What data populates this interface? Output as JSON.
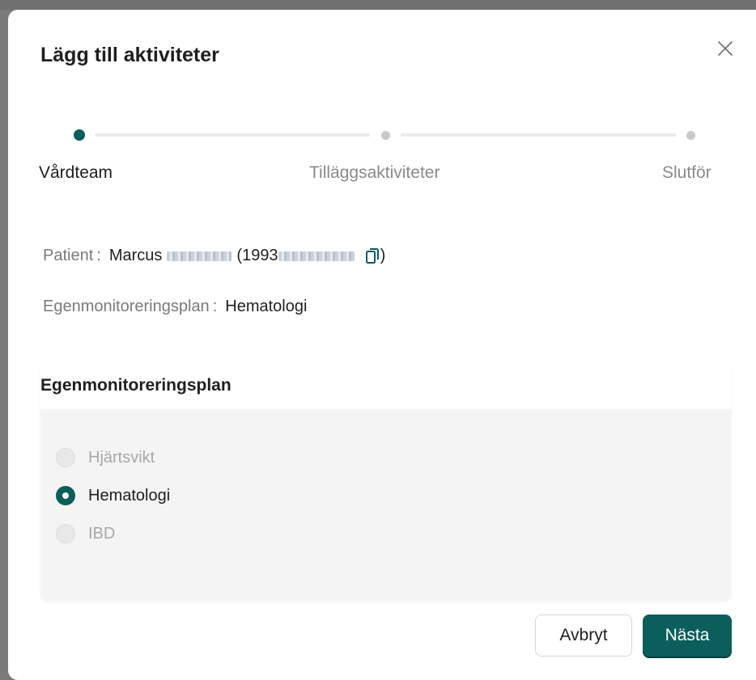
{
  "dialog": {
    "title": "Lägg till aktiviteter"
  },
  "stepper": {
    "steps": [
      {
        "label": "Vårdteam",
        "state": "active"
      },
      {
        "label": "Tilläggsaktiviteter",
        "state": "inactive"
      },
      {
        "label": "Slutför",
        "state": "inactive"
      }
    ]
  },
  "info": {
    "patient_key": "Patient",
    "patient_first_name": "Marcus",
    "patient_id_prefix": "(1993",
    "patient_id_suffix": ")",
    "plan_key": "Egenmonitoreringsplan",
    "plan_value": "Hematologi",
    "separator": ":"
  },
  "card": {
    "title": "Egenmonitoreringsplan",
    "options": [
      {
        "label": "Hjärtsvikt",
        "state": "disabled"
      },
      {
        "label": "Hematologi",
        "state": "checked"
      },
      {
        "label": "IBD",
        "state": "disabled"
      }
    ]
  },
  "buttons": {
    "cancel": "Avbryt",
    "next": "Nästa"
  },
  "colors": {
    "primary": "#0b5e5b",
    "muted_text": "#8a8a8a",
    "card_body_bg": "#f4f4f4"
  }
}
